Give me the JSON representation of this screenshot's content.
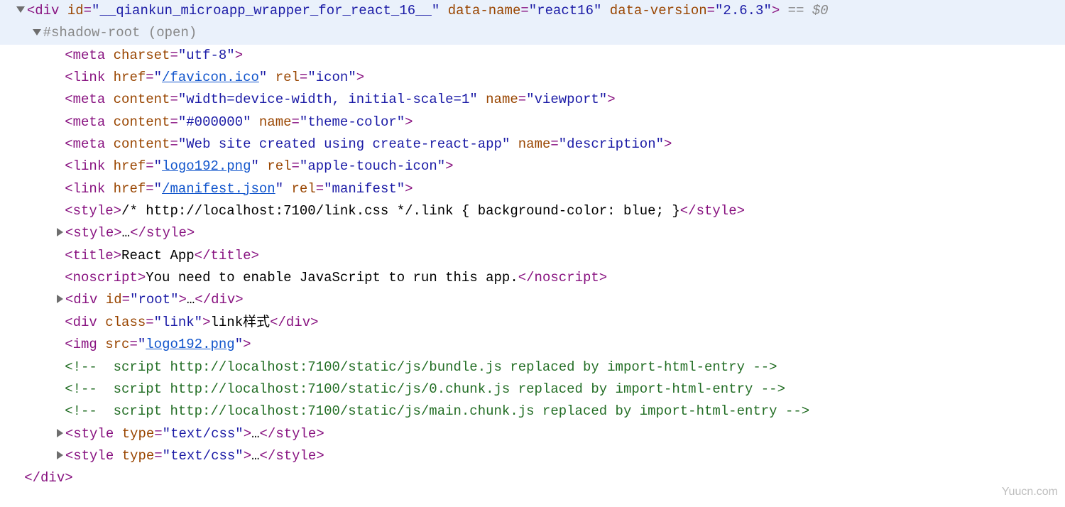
{
  "l1": {
    "indent": "  ",
    "tag_open": "<div ",
    "id_name": "id",
    "id_val": "\"__qiankun_microapp_wrapper_for_react_16__\"",
    "dn_name": "data-name",
    "dn_val": "\"react16\"",
    "dv_name": "data-version",
    "dv_val": "\"2.6.3\"",
    "tag_close": ">",
    "trail": " == ",
    "trail2": "$0"
  },
  "l2": {
    "indent": "    ",
    "text": "#shadow-root (open)"
  },
  "l3": {
    "indent": "        ",
    "open": "<meta ",
    "a1n": "charset",
    "a1v": "\"utf-8\"",
    "close": ">"
  },
  "l4": {
    "indent": "        ",
    "open": "<link ",
    "a1n": "href",
    "a1v_pre": "\"",
    "a1v_link": "/favicon.ico",
    "a1v_post": "\"",
    "a2n": "rel",
    "a2v": "\"icon\"",
    "close": ">"
  },
  "l5": {
    "indent": "        ",
    "open": "<meta ",
    "a1n": "content",
    "a1v": "\"width=device-width, initial-scale=1\"",
    "a2n": "name",
    "a2v": "\"viewport\"",
    "close": ">"
  },
  "l6": {
    "indent": "        ",
    "open": "<meta ",
    "a1n": "content",
    "a1v": "\"#000000\"",
    "a2n": "name",
    "a2v": "\"theme-color\"",
    "close": ">"
  },
  "l7": {
    "indent": "        ",
    "open": "<meta ",
    "a1n": "content",
    "a1v": "\"Web site created using create-react-app\"",
    "a2n": "name",
    "a2v": "\"description\"",
    "close": ">"
  },
  "l8": {
    "indent": "        ",
    "open": "<link ",
    "a1n": "href",
    "a1v_pre": "\"",
    "a1v_link": "logo192.png",
    "a1v_post": "\"",
    "a2n": "rel",
    "a2v": "\"apple-touch-icon\"",
    "close": ">"
  },
  "l9": {
    "indent": "        ",
    "open": "<link ",
    "a1n": "href",
    "a1v_pre": "\"",
    "a1v_link": "/manifest.json",
    "a1v_post": "\"",
    "a2n": "rel",
    "a2v": "\"manifest\"",
    "close": ">"
  },
  "l10": {
    "indent": "        ",
    "open": "<style>",
    "text": "/* http://localhost:7100/link.css */.link { background-color: blue; }",
    "close": "</style>"
  },
  "l11": {
    "indent": "       ",
    "open": "<style>",
    "ell": "…",
    "close": "</style>"
  },
  "l12": {
    "indent": "        ",
    "open": "<title>",
    "text": "React App",
    "close": "</title>"
  },
  "l13": {
    "indent": "        ",
    "open": "<noscript>",
    "text": "You need to enable JavaScript to run this app.",
    "close": "</noscript>"
  },
  "l14": {
    "indent": "       ",
    "open": "<div ",
    "a1n": "id",
    "a1v": "\"root\"",
    "mid": ">",
    "ell": "…",
    "close": "</div>"
  },
  "l15": {
    "indent": "        ",
    "open": "<div ",
    "a1n": "class",
    "a1v": "\"link\"",
    "mid": ">",
    "text": "link样式",
    "close": "</div>"
  },
  "l16": {
    "indent": "        ",
    "open": "<img ",
    "a1n": "src",
    "a1v_pre": "\"",
    "a1v_link": "logo192.png",
    "a1v_post": "\"",
    "close": ">"
  },
  "l17": {
    "indent": "        ",
    "text": "<!--  script http://localhost:7100/static/js/bundle.js replaced by import-html-entry -->"
  },
  "l18": {
    "indent": "        ",
    "text": "<!--  script http://localhost:7100/static/js/0.chunk.js replaced by import-html-entry -->"
  },
  "l19": {
    "indent": "        ",
    "text": "<!--  script http://localhost:7100/static/js/main.chunk.js replaced by import-html-entry -->"
  },
  "l20": {
    "indent": "       ",
    "open": "<style ",
    "a1n": "type",
    "a1v": "\"text/css\"",
    "mid": ">",
    "ell": "…",
    "close": "</style>"
  },
  "l21": {
    "indent": "       ",
    "open": "<style ",
    "a1n": "type",
    "a1v": "\"text/css\"",
    "mid": ">",
    "ell": "…",
    "close": "</style>"
  },
  "l22": {
    "indent": "   ",
    "close": "</div>"
  },
  "watermark": "Yuucn.com"
}
